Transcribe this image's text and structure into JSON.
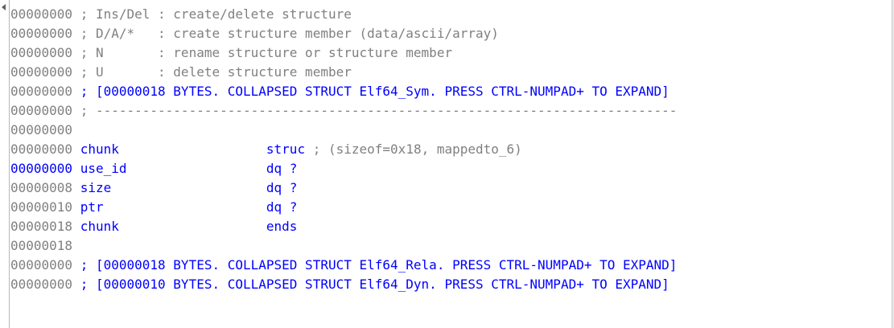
{
  "lines": [
    {
      "addr": "00000000",
      "kind": "comment",
      "text": "; Ins/Del : create/delete structure"
    },
    {
      "addr": "00000000",
      "kind": "comment",
      "text": "; D/A/*   : create structure member (data/ascii/array)"
    },
    {
      "addr": "00000000",
      "kind": "comment",
      "text": "; N       : rename structure or structure member"
    },
    {
      "addr": "00000000",
      "kind": "comment",
      "text": "; U       : delete structure member"
    },
    {
      "addr": "00000000",
      "kind": "collapsed",
      "text": "; [00000018 BYTES. COLLAPSED STRUCT Elf64_Sym. PRESS CTRL-NUMPAD+ TO EXPAND]"
    },
    {
      "addr": "00000000",
      "kind": "comment",
      "text": "; ---------------------------------------------------------------------------"
    },
    {
      "addr": "00000000",
      "kind": "blank",
      "text": ""
    },
    {
      "addr": "00000000",
      "kind": "struct",
      "name": "chunk",
      "op": "struc",
      "comment": "; (sizeof=0x18, mappedto_6)"
    },
    {
      "addr": "00000000",
      "kind": "member",
      "active": true,
      "name": "use_id",
      "op": "dq ?"
    },
    {
      "addr": "00000008",
      "kind": "member",
      "name": "size",
      "op": "dq ?"
    },
    {
      "addr": "00000010",
      "kind": "member",
      "name": "ptr",
      "op": "dq ?"
    },
    {
      "addr": "00000018",
      "kind": "member",
      "name": "chunk",
      "op": "ends"
    },
    {
      "addr": "00000018",
      "kind": "blank",
      "text": ""
    },
    {
      "addr": "00000000",
      "kind": "collapsed",
      "text": "; [00000018 BYTES. COLLAPSED STRUCT Elf64_Rela. PRESS CTRL-NUMPAD+ TO EXPAND]"
    },
    {
      "addr": "00000000",
      "kind": "collapsed",
      "text": "; [00000010 BYTES. COLLAPSED STRUCT Elf64_Dyn. PRESS CTRL-NUMPAD+ TO EXPAND]"
    }
  ],
  "colors": {
    "address": "#808080",
    "address_active": "#0000ff",
    "comment": "#808080",
    "identifier": "#0000ff",
    "background": "#ffffff"
  }
}
